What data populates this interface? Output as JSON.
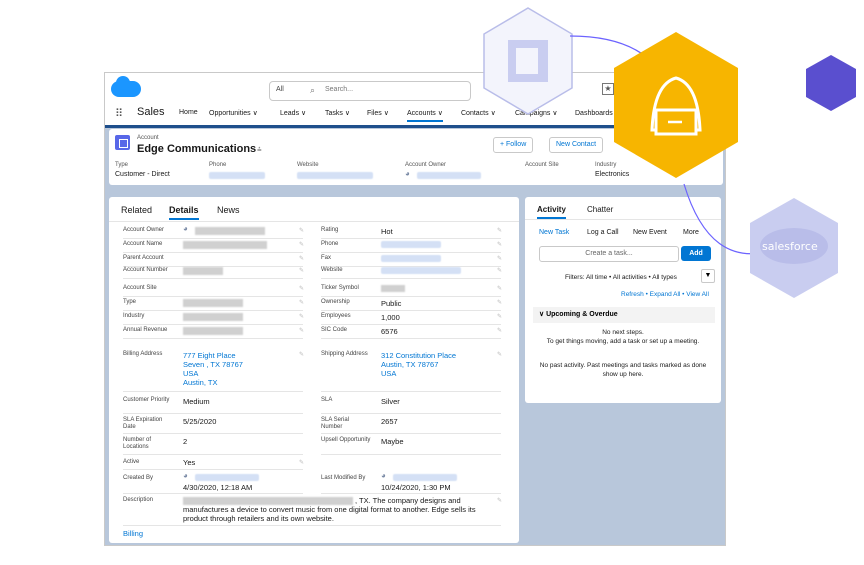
{
  "topbar": {
    "search_scope": "All",
    "search_placeholder": "Search..."
  },
  "nav": {
    "app_name": "Sales",
    "items": [
      "Home",
      "Opportunities",
      "Leads",
      "Tasks",
      "Files",
      "Accounts",
      "Contacts",
      "Campaigns",
      "Dashboards"
    ],
    "item_suffix": "∨",
    "active": "Accounts",
    "truncated_item": "N"
  },
  "header": {
    "object_type": "Account",
    "account_name": "Edge Communications",
    "follow_label": "+ Follow",
    "new_contact_label": "New Contact",
    "highlights": [
      {
        "label": "Type",
        "value": "Customer - Direct"
      },
      {
        "label": "Phone",
        "value": ""
      },
      {
        "label": "Website",
        "value": ""
      },
      {
        "label": "Account Owner",
        "value": ""
      },
      {
        "label": "Account Site",
        "value": ""
      },
      {
        "label": "Industry",
        "value": "Electronics"
      }
    ]
  },
  "details": {
    "tabs": [
      "Related",
      "Details",
      "News"
    ],
    "active_tab": "Details",
    "left_fields": [
      {
        "label": "Account Owner",
        "value": ""
      },
      {
        "label": "Account Name",
        "value": ""
      },
      {
        "label": "Parent Account",
        "value": ""
      },
      {
        "label": "Account Number",
        "value": ""
      },
      {
        "label": "Account Site",
        "value": ""
      },
      {
        "label": "Type",
        "value": ""
      },
      {
        "label": "Industry",
        "value": ""
      },
      {
        "label": "Annual Revenue",
        "value": ""
      }
    ],
    "right_fields": [
      {
        "label": "Rating",
        "value": "Hot"
      },
      {
        "label": "Phone",
        "value": ""
      },
      {
        "label": "Fax",
        "value": ""
      },
      {
        "label": "Website",
        "value": ""
      },
      {
        "label": "Ticker Symbol",
        "value": ""
      },
      {
        "label": "Ownership",
        "value": "Public"
      },
      {
        "label": "Employees",
        "value": "1,000"
      },
      {
        "label": "SIC Code",
        "value": "6576"
      }
    ],
    "billing": {
      "label": "Billing Address",
      "lines": [
        "777 Eight Place",
        "Seven , TX 78767",
        "USA",
        "Austin, TX"
      ]
    },
    "shipping": {
      "label": "Shipping Address",
      "lines": [
        "312 Constitution Place",
        "Austin, TX 78767",
        "USA"
      ]
    },
    "customer_priority": {
      "label": "Customer Priority",
      "value": "Medium"
    },
    "sla": {
      "label": "SLA",
      "value": "Silver"
    },
    "sla_expiration": {
      "label": "SLA Expiration Date",
      "value": "5/25/2020"
    },
    "sla_serial": {
      "label": "SLA Serial Number",
      "value": "2657"
    },
    "locations": {
      "label": "Number of Locations",
      "value": "2"
    },
    "upsell": {
      "label": "Upsell Opportunity",
      "value": "Maybe"
    },
    "active": {
      "label": "Active",
      "value": "Yes"
    },
    "created_by": {
      "label": "Created By",
      "value": "4/30/2020, 12:18 AM"
    },
    "modified_by": {
      "label": "Last Modified By",
      "value": "10/24/2020, 1:30 PM"
    },
    "description": {
      "label": "Description",
      "line1": ", TX. The company designs and",
      "line2": "manufactures a device to convert music from one digital format to another. Edge sells its",
      "line3": "product through retailers and its own website."
    },
    "billing_section": "Billing"
  },
  "activity": {
    "tabs": [
      "Activity",
      "Chatter"
    ],
    "subtabs": [
      "New Task",
      "Log a Call",
      "New Event",
      "More"
    ],
    "task_placeholder": "Create a task...",
    "add_label": "Add",
    "filters": "Filters: All time • All activities • All types",
    "links": "Refresh • Expand All • View All",
    "upcoming": "Upcoming & Overdue",
    "no_steps": "No next steps.",
    "no_steps_sub": "To get things moving, add a task or set up a meeting.",
    "no_past": "No past activity. Past meetings and tasks marked as done show up here."
  },
  "overlay": {
    "salesforce_label": "salesforce"
  },
  "colors": {
    "brand_blue": "#0176d3",
    "hacker_hex": "#f7b500",
    "purple_hex": "#5a4fcf",
    "office_hex": "#c9cdf0"
  }
}
